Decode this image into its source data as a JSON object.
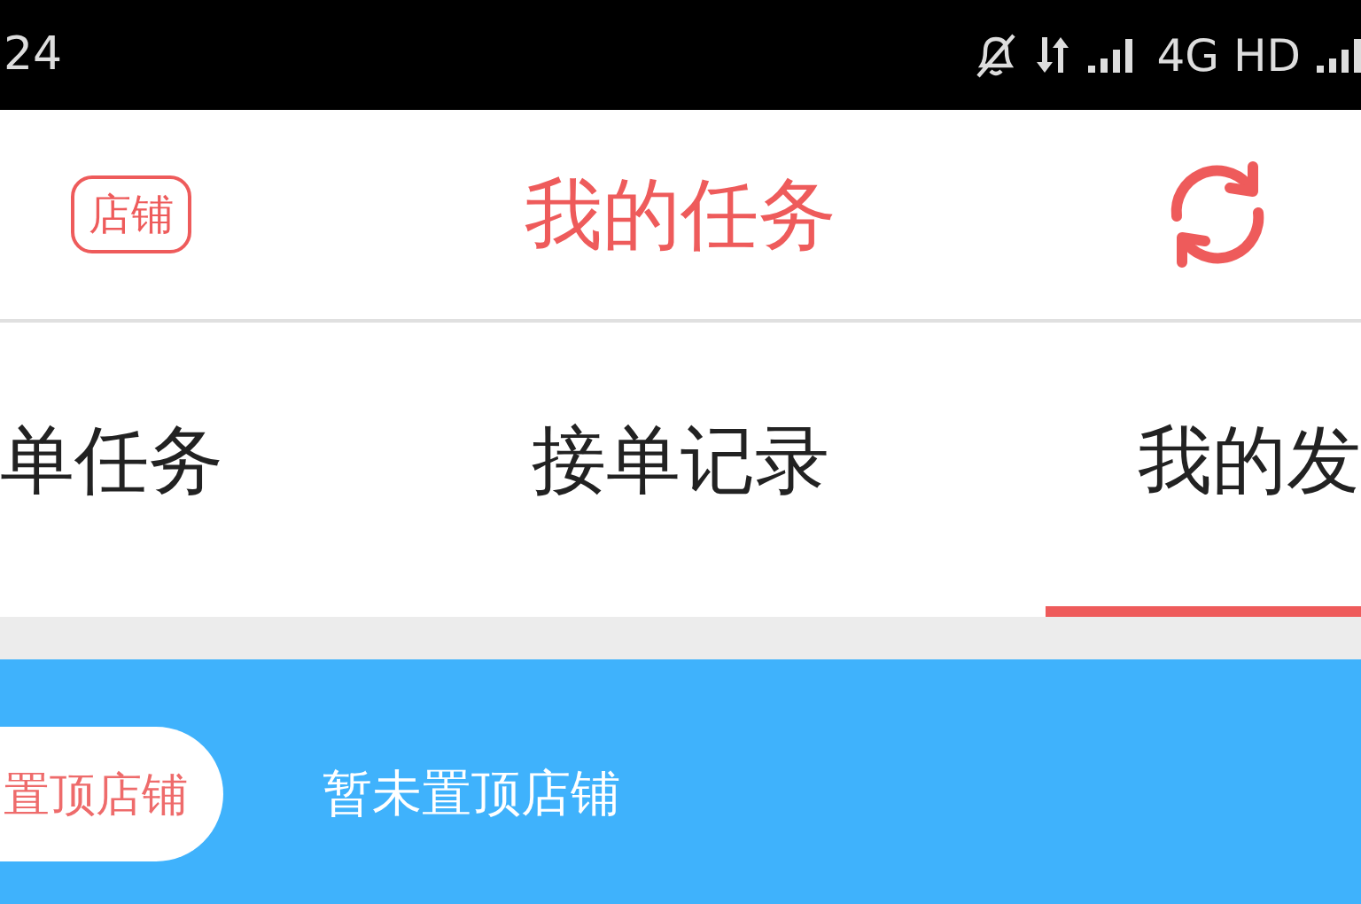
{
  "status_bar": {
    "time": "24",
    "network": "4G HD"
  },
  "header": {
    "shop_button": "店铺",
    "title": "我的任务"
  },
  "tabs": [
    {
      "label": "单任务",
      "selected": false
    },
    {
      "label": "接单记录",
      "selected": false
    },
    {
      "label": "我的发",
      "selected": true
    }
  ],
  "pinned": {
    "button": "置顶店铺",
    "message": "暂未置顶店铺"
  }
}
